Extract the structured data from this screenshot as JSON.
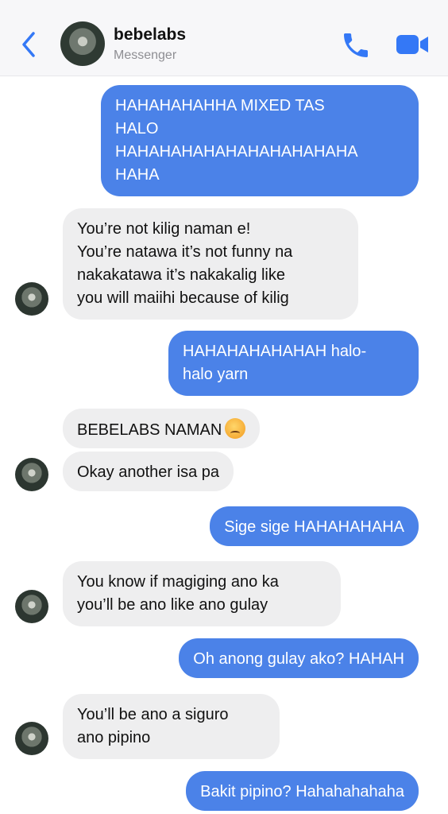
{
  "header": {
    "contact_name": "bebelabs",
    "subtitle": "Messenger",
    "icons": [
      "chevron-left-icon",
      "phone-icon",
      "video-camera-icon"
    ],
    "accent_color": "#3478f6"
  },
  "messages": [
    {
      "side": "out",
      "text": "HAHAHAHAHHA MIXED TAS\nHALO\nHAHAHAHAHAHAHAHAHAHAHA\nHAHA"
    },
    {
      "side": "in",
      "text": "You’re not kilig naman e!\nYou’re natawa it’s not funny na\nnakakatawa it’s nakakalig like\nyou will maiihi because of kilig"
    },
    {
      "side": "out",
      "text": "HAHAHAHAHAHAH halo-\nhalo yarn"
    },
    {
      "side": "in",
      "text": "BEBELABS NAMAN",
      "emoji": "angry-face-emoji"
    },
    {
      "side": "in",
      "text": "Okay another isa pa"
    },
    {
      "side": "out",
      "text": "Sige sige HAHAHAHAHA"
    },
    {
      "side": "in",
      "text": "You know if magiging ano ka\nyou’ll be ano like ano gulay"
    },
    {
      "side": "out",
      "text": "Oh anong gulay ako? HAHAH"
    },
    {
      "side": "in",
      "text": "You’ll be ano a siguro\nano pipino"
    },
    {
      "side": "out",
      "text": "Bakit pipino? Hahahahahaha"
    }
  ],
  "colors": {
    "outgoing_bubble": "#4b82e8",
    "incoming_bubble": "#eeeeef"
  }
}
